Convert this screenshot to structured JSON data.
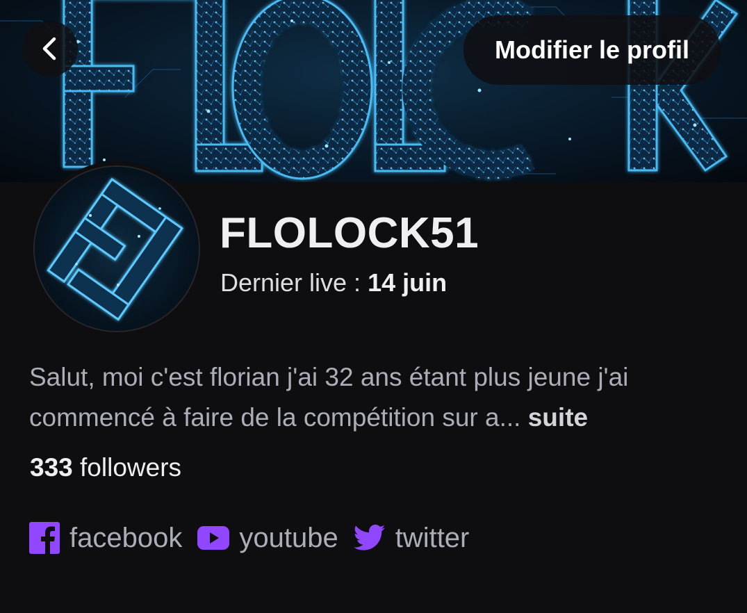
{
  "header": {
    "back_icon": "chevron-left-icon",
    "edit_profile_label": "Modifier le profil"
  },
  "banner": {
    "logo_text": "FLOLOCK"
  },
  "profile": {
    "username": "FLOLOCK51",
    "last_live_label": "Dernier live : ",
    "last_live_date": "14 juin",
    "bio_text": "Salut, moi c'est florian j'ai 32 ans étant plus jeune j'ai commencé à faire de la compétition sur a...",
    "bio_more": "suite",
    "followers_count": "333",
    "followers_label": "followers"
  },
  "socials": [
    {
      "label": "facebook",
      "icon": "facebook-icon"
    },
    {
      "label": "youtube",
      "icon": "youtube-icon"
    },
    {
      "label": "twitter",
      "icon": "twitter-icon"
    }
  ],
  "colors": {
    "background": "#0e0e10",
    "accent": "#9147ff",
    "neon": "#37c0ff"
  }
}
